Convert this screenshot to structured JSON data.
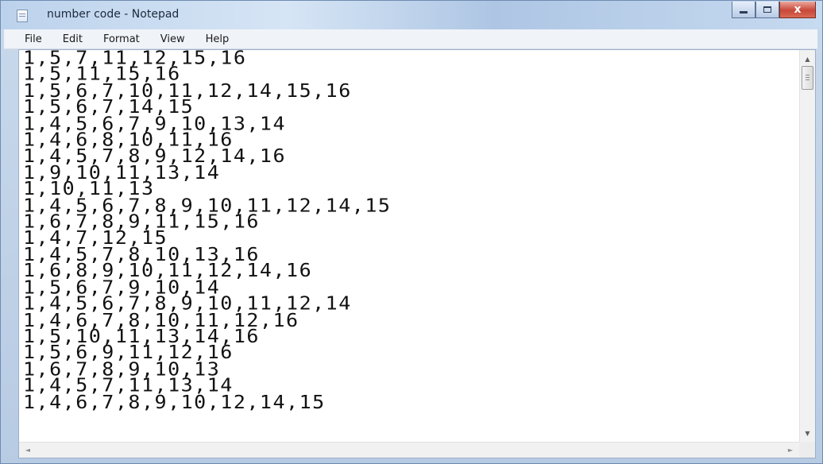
{
  "window": {
    "title": "number code - Notepad",
    "close_glyph": "x"
  },
  "menu": [
    "File",
    "Edit",
    "Format",
    "View",
    "Help"
  ],
  "editor": {
    "lines": [
      "1,5,7,11,12,15,16",
      "1,5,11,15,16",
      "1,5,6,7,10,11,12,14,15,16",
      "1,5,6,7,14,15",
      "1,4,5,6,7,9,10,13,14",
      "1,4,6,8,10,11,16",
      "1,4,5,7,8,9,12,14,16",
      "1,9,10,11,13,14",
      "1,10,11,13",
      "1,4,5,6,7,8,9,10,11,12,14,15",
      "1,6,7,8,9,11,15,16",
      "1,4,7,12,15",
      "1,4,5,7,8,10,13,16",
      "1,6,8,9,10,11,12,14,16",
      "1,5,6,7,9,10,14",
      "1,4,5,6,7,8,9,10,11,12,14",
      "1,4,6,7,8,10,11,12,16",
      "1,5,10,11,13,14,16",
      "1,5,6,9,11,12,16",
      "1,6,7,8,9,10,13",
      "1,4,5,7,11,13,14",
      "1,4,6,7,8,9,10,12,14,15"
    ]
  },
  "scrollbars": {
    "up_arrow": "▲",
    "down_arrow": "▼",
    "left_arrow": "◄",
    "right_arrow": "►"
  }
}
